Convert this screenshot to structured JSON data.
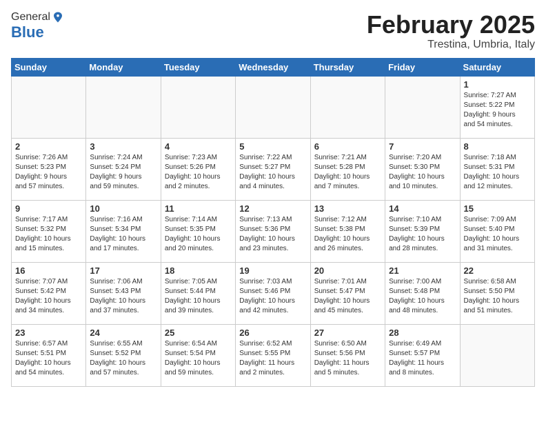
{
  "header": {
    "logo_general": "General",
    "logo_blue": "Blue",
    "title": "February 2025",
    "subtitle": "Trestina, Umbria, Italy"
  },
  "weekdays": [
    "Sunday",
    "Monday",
    "Tuesday",
    "Wednesday",
    "Thursday",
    "Friday",
    "Saturday"
  ],
  "weeks": [
    [
      {
        "day": "",
        "info": ""
      },
      {
        "day": "",
        "info": ""
      },
      {
        "day": "",
        "info": ""
      },
      {
        "day": "",
        "info": ""
      },
      {
        "day": "",
        "info": ""
      },
      {
        "day": "",
        "info": ""
      },
      {
        "day": "1",
        "info": "Sunrise: 7:27 AM\nSunset: 5:22 PM\nDaylight: 9 hours\nand 54 minutes."
      }
    ],
    [
      {
        "day": "2",
        "info": "Sunrise: 7:26 AM\nSunset: 5:23 PM\nDaylight: 9 hours\nand 57 minutes."
      },
      {
        "day": "3",
        "info": "Sunrise: 7:24 AM\nSunset: 5:24 PM\nDaylight: 9 hours\nand 59 minutes."
      },
      {
        "day": "4",
        "info": "Sunrise: 7:23 AM\nSunset: 5:26 PM\nDaylight: 10 hours\nand 2 minutes."
      },
      {
        "day": "5",
        "info": "Sunrise: 7:22 AM\nSunset: 5:27 PM\nDaylight: 10 hours\nand 4 minutes."
      },
      {
        "day": "6",
        "info": "Sunrise: 7:21 AM\nSunset: 5:28 PM\nDaylight: 10 hours\nand 7 minutes."
      },
      {
        "day": "7",
        "info": "Sunrise: 7:20 AM\nSunset: 5:30 PM\nDaylight: 10 hours\nand 10 minutes."
      },
      {
        "day": "8",
        "info": "Sunrise: 7:18 AM\nSunset: 5:31 PM\nDaylight: 10 hours\nand 12 minutes."
      }
    ],
    [
      {
        "day": "9",
        "info": "Sunrise: 7:17 AM\nSunset: 5:32 PM\nDaylight: 10 hours\nand 15 minutes."
      },
      {
        "day": "10",
        "info": "Sunrise: 7:16 AM\nSunset: 5:34 PM\nDaylight: 10 hours\nand 17 minutes."
      },
      {
        "day": "11",
        "info": "Sunrise: 7:14 AM\nSunset: 5:35 PM\nDaylight: 10 hours\nand 20 minutes."
      },
      {
        "day": "12",
        "info": "Sunrise: 7:13 AM\nSunset: 5:36 PM\nDaylight: 10 hours\nand 23 minutes."
      },
      {
        "day": "13",
        "info": "Sunrise: 7:12 AM\nSunset: 5:38 PM\nDaylight: 10 hours\nand 26 minutes."
      },
      {
        "day": "14",
        "info": "Sunrise: 7:10 AM\nSunset: 5:39 PM\nDaylight: 10 hours\nand 28 minutes."
      },
      {
        "day": "15",
        "info": "Sunrise: 7:09 AM\nSunset: 5:40 PM\nDaylight: 10 hours\nand 31 minutes."
      }
    ],
    [
      {
        "day": "16",
        "info": "Sunrise: 7:07 AM\nSunset: 5:42 PM\nDaylight: 10 hours\nand 34 minutes."
      },
      {
        "day": "17",
        "info": "Sunrise: 7:06 AM\nSunset: 5:43 PM\nDaylight: 10 hours\nand 37 minutes."
      },
      {
        "day": "18",
        "info": "Sunrise: 7:05 AM\nSunset: 5:44 PM\nDaylight: 10 hours\nand 39 minutes."
      },
      {
        "day": "19",
        "info": "Sunrise: 7:03 AM\nSunset: 5:46 PM\nDaylight: 10 hours\nand 42 minutes."
      },
      {
        "day": "20",
        "info": "Sunrise: 7:01 AM\nSunset: 5:47 PM\nDaylight: 10 hours\nand 45 minutes."
      },
      {
        "day": "21",
        "info": "Sunrise: 7:00 AM\nSunset: 5:48 PM\nDaylight: 10 hours\nand 48 minutes."
      },
      {
        "day": "22",
        "info": "Sunrise: 6:58 AM\nSunset: 5:50 PM\nDaylight: 10 hours\nand 51 minutes."
      }
    ],
    [
      {
        "day": "23",
        "info": "Sunrise: 6:57 AM\nSunset: 5:51 PM\nDaylight: 10 hours\nand 54 minutes."
      },
      {
        "day": "24",
        "info": "Sunrise: 6:55 AM\nSunset: 5:52 PM\nDaylight: 10 hours\nand 57 minutes."
      },
      {
        "day": "25",
        "info": "Sunrise: 6:54 AM\nSunset: 5:54 PM\nDaylight: 10 hours\nand 59 minutes."
      },
      {
        "day": "26",
        "info": "Sunrise: 6:52 AM\nSunset: 5:55 PM\nDaylight: 11 hours\nand 2 minutes."
      },
      {
        "day": "27",
        "info": "Sunrise: 6:50 AM\nSunset: 5:56 PM\nDaylight: 11 hours\nand 5 minutes."
      },
      {
        "day": "28",
        "info": "Sunrise: 6:49 AM\nSunset: 5:57 PM\nDaylight: 11 hours\nand 8 minutes."
      },
      {
        "day": "",
        "info": ""
      }
    ]
  ]
}
